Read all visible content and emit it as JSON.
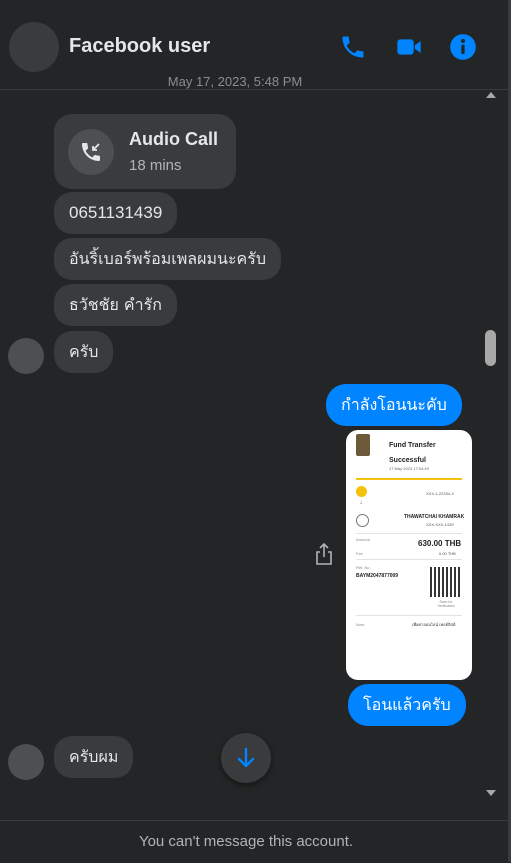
{
  "header": {
    "title": "Facebook user",
    "accent_color": "#0084ff",
    "icons": [
      "phone-icon",
      "video-camera-icon",
      "info-icon"
    ]
  },
  "timestamp": "May 17, 2023, 5:48 PM",
  "messages": {
    "call": {
      "title": "Audio Call",
      "duration": "18 mins",
      "icon": "missed-call-icon"
    },
    "in_1": "0651131439",
    "in_2": "อันริ้เบอร์พร้อมเพลผมนะครับ",
    "in_3": "ธวัชชัย คำรัก",
    "in_4": "ครับ",
    "out_1": "กำลังโอนนะคับ",
    "out_2": "โอนแล้วครับ",
    "in_5": "ครับผม"
  },
  "slip": {
    "title": "Fund Transfer",
    "status": "Successful",
    "date": "17 May 2023 17:04:49",
    "from_account": "XXX-1-22334-X",
    "to_name": "THAWATCHAI KHAMRAK",
    "to_account": "XXX-XXX-1439",
    "amount_label": "Amount",
    "amount": "630.00 THB",
    "fee_label": "Fee",
    "fee": "0.00 THB",
    "ref_label": "Ref. No.",
    "ref_no": "BAYM2047877009",
    "scan_label": "Scan for Verification",
    "note_label": "Note",
    "note": "เพื่อค่าออนไลน์ เพลย์ลิสต์"
  },
  "footer": {
    "notice": "You can't message this account."
  }
}
